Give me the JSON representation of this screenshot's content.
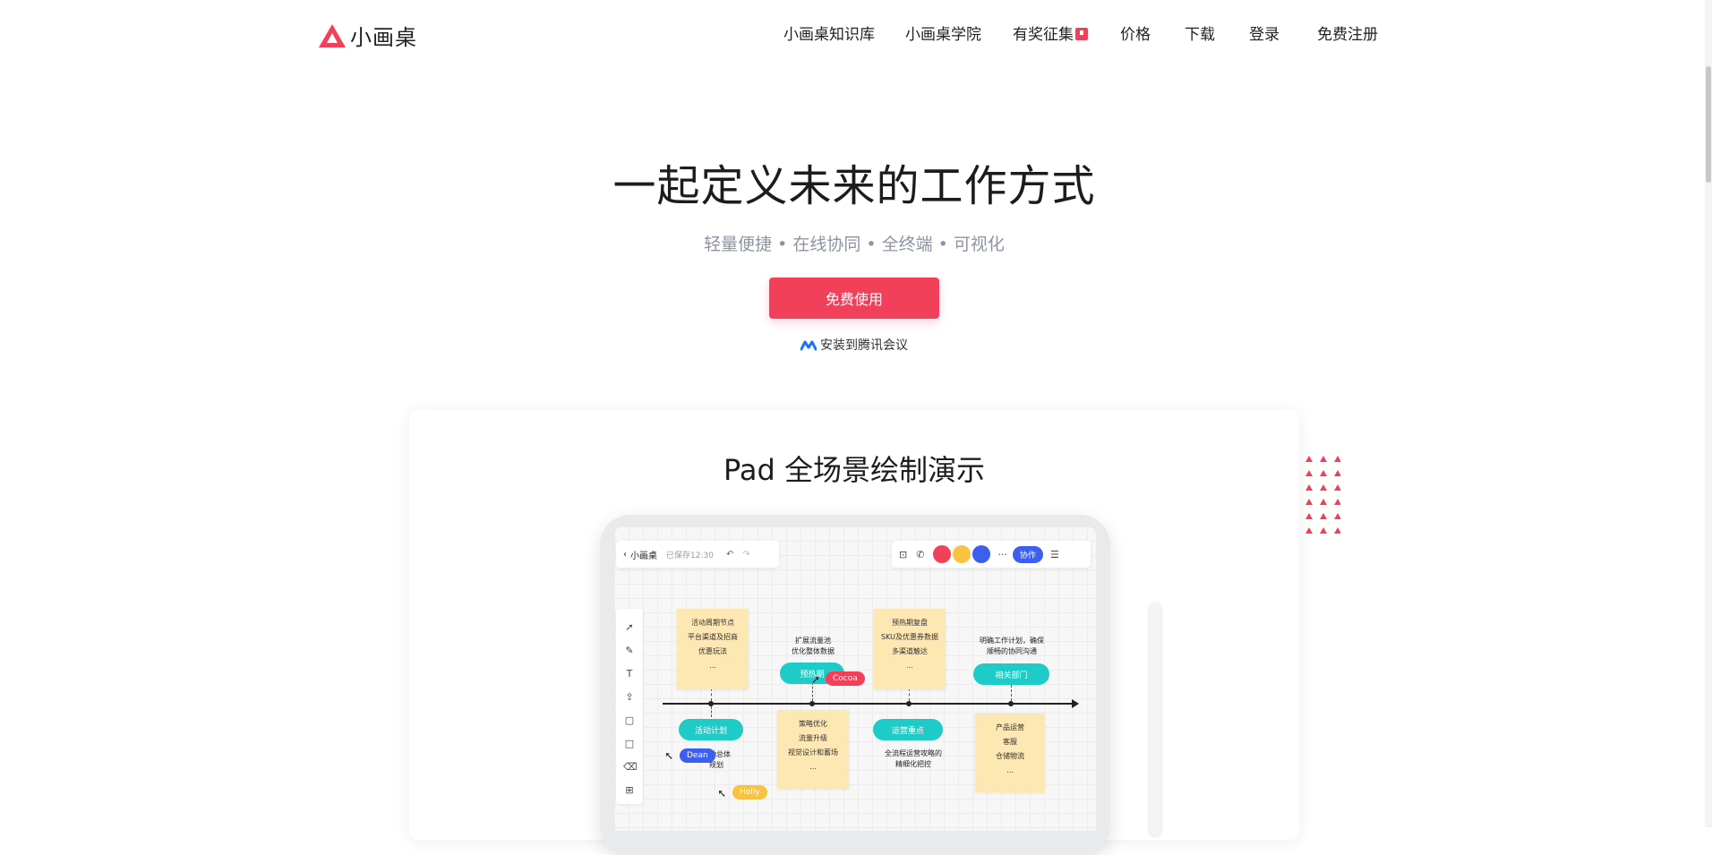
{
  "brand": {
    "name": "小画桌",
    "accent": "#f23f5a"
  },
  "nav": {
    "items": [
      {
        "label": "小画桌知识库"
      },
      {
        "label": "小画桌学院"
      },
      {
        "label": "有奖征集"
      },
      {
        "label": "价格"
      },
      {
        "label": "下载"
      },
      {
        "label": "登录"
      },
      {
        "label": "免费注册"
      }
    ]
  },
  "hero": {
    "title": "一起定义未来的工作方式",
    "subtitle": "轻量便捷 • 在线协同 • 全终端 • 可视化",
    "cta_label": "免费使用",
    "tencent_label": "安装到腾讯会议"
  },
  "demo": {
    "title": "Pad 全场景绘制演示",
    "app": {
      "back_label": "小画桌",
      "saved_label": "已保存12:30",
      "collab_label": "协作",
      "more_label": "···"
    },
    "board": {
      "stickies": [
        {
          "lines": [
            "活动周期节点",
            "平台渠道及招商",
            "优惠玩法",
            "..."
          ]
        },
        {
          "lines": [
            "预热期复盘",
            "SKU及优惠券数据",
            "多渠道触达",
            "..."
          ]
        },
        {
          "lines": [
            "策略优化",
            "流量升级",
            "视觉设计和蓄场",
            "..."
          ]
        },
        {
          "lines": [
            "产品运营",
            "客服",
            "仓储物流",
            "..."
          ]
        }
      ],
      "pills": [
        "活动计划",
        "预热期",
        "运营重点",
        "相关部门"
      ],
      "notes": [
        {
          "lines": [
            "扩展流量池",
            "优化整体数据"
          ]
        },
        {
          "lines": [
            "明确工作计划，确保",
            "顺畅的协同沟通"
          ]
        },
        {
          "lines": [
            "全流程运营攻略的",
            "精细化把控"
          ]
        },
        {
          "lines": [
            "活动总体",
            "规划"
          ]
        }
      ],
      "cursors": [
        {
          "name": "Cocoa",
          "color": "#f23f5a"
        },
        {
          "name": "Dean",
          "color": "#3c5ff0"
        },
        {
          "name": "Holly",
          "color": "#f7c340"
        }
      ]
    }
  }
}
